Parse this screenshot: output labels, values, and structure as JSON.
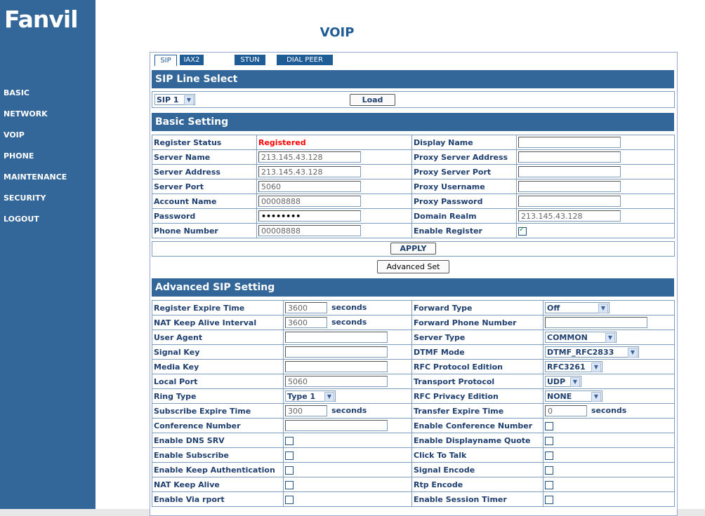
{
  "brand": "Fanvil",
  "nav": [
    "BASIC",
    "NETWORK",
    "VOIP",
    "PHONE",
    "MAINTENANCE",
    "SECURITY",
    "LOGOUT"
  ],
  "title": "VOIP",
  "tabs": [
    "SIP",
    "IAX2",
    "STUN",
    "DIAL PEER"
  ],
  "line_select": {
    "header": "SIP Line Select",
    "value": "SIP 1",
    "load_label": "Load"
  },
  "basic": {
    "header": "Basic Setting",
    "left": [
      {
        "label": "Register Status",
        "value": "Registered"
      },
      {
        "label": "Server Name",
        "value": "213.145.43.128"
      },
      {
        "label": "Server Address",
        "value": "213.145.43.128"
      },
      {
        "label": "Server Port",
        "value": "5060"
      },
      {
        "label": "Account Name",
        "value": "00008888"
      },
      {
        "label": "Password",
        "value": "••••••••"
      },
      {
        "label": "Phone Number",
        "value": "00008888"
      }
    ],
    "right": [
      {
        "label": "Display Name",
        "value": ""
      },
      {
        "label": "Proxy Server Address",
        "value": ""
      },
      {
        "label": "Proxy Server Port",
        "value": ""
      },
      {
        "label": "Proxy Username",
        "value": ""
      },
      {
        "label": "Proxy Password",
        "value": ""
      },
      {
        "label": "Domain Realm",
        "value": "213.145.43.128"
      },
      {
        "label": "Enable Register",
        "checked": true
      }
    ],
    "apply_label": "APPLY",
    "advanced_label": "Advanced Set"
  },
  "advanced": {
    "header": "Advanced SIP Setting",
    "seconds": "seconds",
    "left": [
      {
        "label": "Register Expire Time",
        "value": "3600"
      },
      {
        "label": "NAT Keep Alive Interval",
        "value": "3600"
      },
      {
        "label": "User Agent",
        "value": ""
      },
      {
        "label": "Signal Key",
        "value": ""
      },
      {
        "label": "Media Key",
        "value": ""
      },
      {
        "label": "Local Port",
        "value": "5060"
      },
      {
        "label": "Ring Type",
        "value": "Type 1"
      },
      {
        "label": "Subscribe Expire Time",
        "value": "300"
      },
      {
        "label": "Conference Number",
        "value": ""
      },
      {
        "label": "Enable DNS SRV",
        "checked": false
      },
      {
        "label": "Enable Subscribe",
        "checked": false
      },
      {
        "label": "Enable Keep Authentication",
        "checked": false
      },
      {
        "label": "NAT Keep Alive",
        "checked": false
      },
      {
        "label": "Enable Via rport",
        "checked": false
      }
    ],
    "right": [
      {
        "label": "Forward Type",
        "value": "Off"
      },
      {
        "label": "Forward Phone Number",
        "value": ""
      },
      {
        "label": "Server Type",
        "value": "COMMON"
      },
      {
        "label": "DTMF Mode",
        "value": "DTMF_RFC2833"
      },
      {
        "label": "RFC Protocol Edition",
        "value": "RFC3261"
      },
      {
        "label": "Transport Protocol",
        "value": "UDP"
      },
      {
        "label": "RFC Privacy Edition",
        "value": "NONE"
      },
      {
        "label": "Transfer Expire Time",
        "value": "0"
      },
      {
        "label": "Enable Conference Number",
        "checked": false
      },
      {
        "label": "Enable Displayname Quote",
        "checked": false
      },
      {
        "label": "Click To Talk",
        "checked": false
      },
      {
        "label": "Signal Encode",
        "checked": false
      },
      {
        "label": "Rtp Encode",
        "checked": false
      },
      {
        "label": "Enable Session Timer",
        "checked": false
      }
    ]
  }
}
